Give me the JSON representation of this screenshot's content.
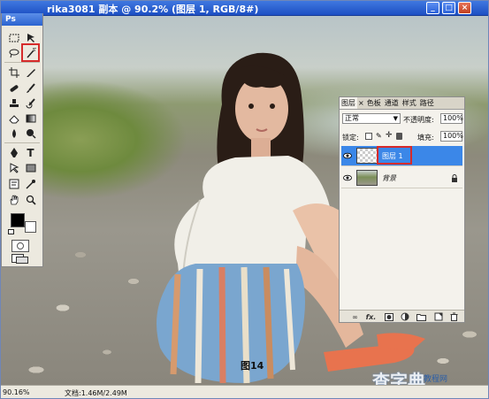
{
  "window": {
    "title": "rika3081 副本 @ 90.2% (图层 1, RGB/8#)",
    "app_badge": "Ps"
  },
  "toolbox": {
    "tools": [
      "rectangular-marquee",
      "move",
      "lasso",
      "magic-wand",
      "crop",
      "slice",
      "healing-brush",
      "brush",
      "clone-stamp",
      "history-brush",
      "eraser",
      "gradient",
      "blur",
      "dodge",
      "pen",
      "type",
      "path-selection",
      "shape",
      "notes",
      "eyedropper",
      "hand",
      "zoom"
    ],
    "selected_tool": "magic-wand",
    "foreground_color": "#000000",
    "background_color": "#ffffff"
  },
  "layers_panel": {
    "tabs": [
      "图层",
      "×",
      "色板",
      "通道",
      "样式",
      "路径"
    ],
    "blend_mode": "正常",
    "opacity_label": "不透明度:",
    "opacity_value": "100%",
    "lock_label": "锁定:",
    "fill_label": "填充:",
    "fill_value": "100%",
    "layers": [
      {
        "name": "图层 1",
        "selected": true,
        "thumbnail": "transparent"
      },
      {
        "name": "背景",
        "selected": false,
        "thumbnail": "photo",
        "locked": true
      }
    ],
    "bottom_icons": [
      "link-icon",
      "fx-icon",
      "mask-icon",
      "adjustment-icon",
      "folder-icon",
      "new-layer-icon",
      "trash-icon"
    ],
    "bottom_fx": "fx."
  },
  "status_bar": {
    "zoom": "90.16%",
    "doc_info": "文档:1.46M/2.49M"
  },
  "canvas": {
    "caption": "图14"
  },
  "watermark": {
    "main": "查字典",
    "sub": "教程网"
  }
}
